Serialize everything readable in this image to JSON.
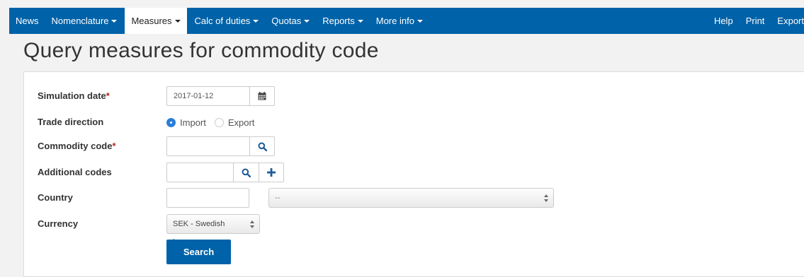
{
  "nav": {
    "left": [
      {
        "label": "News",
        "caret": false,
        "active": false
      },
      {
        "label": "Nomenclature",
        "caret": true,
        "active": false
      },
      {
        "label": "Measures",
        "caret": true,
        "active": true
      },
      {
        "label": "Calc of duties",
        "caret": true,
        "active": false
      },
      {
        "label": "Quotas",
        "caret": true,
        "active": false
      },
      {
        "label": "Reports",
        "caret": true,
        "active": false
      },
      {
        "label": "More info",
        "caret": true,
        "active": false
      }
    ],
    "right": [
      {
        "label": "Help"
      },
      {
        "label": "Print"
      },
      {
        "label": "Export"
      }
    ]
  },
  "page": {
    "title": "Query measures for commodity code"
  },
  "form": {
    "simulation_date": {
      "label": "Simulation date",
      "required_mark": "*",
      "value": "2017-01-12",
      "icon": "calendar-icon"
    },
    "trade_direction": {
      "label": "Trade direction",
      "options": [
        "Import",
        "Export"
      ],
      "selected": "Import"
    },
    "commodity_code": {
      "label": "Commodity code",
      "required_mark": "*",
      "value": "",
      "icon": "search-icon"
    },
    "additional_codes": {
      "label": "Additional codes",
      "value": "",
      "icons": [
        "search-icon",
        "plus-icon"
      ]
    },
    "country": {
      "label": "Country",
      "value": "",
      "select_value": "--"
    },
    "currency": {
      "label": "Currency",
      "selected": "SEK - Swedish krona"
    },
    "search_label": "Search"
  },
  "colors": {
    "brand": "#0062a8",
    "required": "#b3261e",
    "radio_checked": "#2a7ed8",
    "icon": "#1f5c99"
  }
}
